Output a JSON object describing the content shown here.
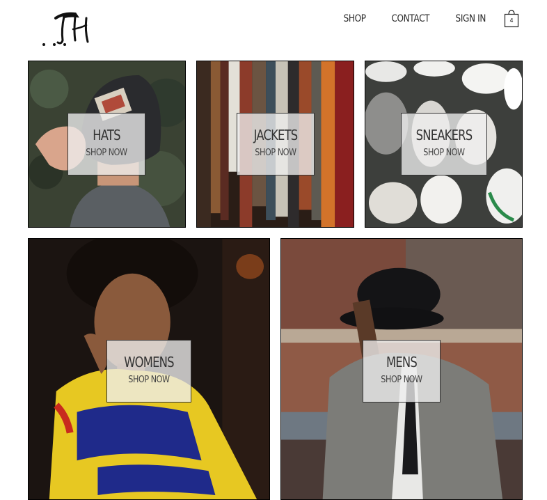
{
  "header": {
    "logo_text": "..TH",
    "nav": [
      {
        "label": "SHOP"
      },
      {
        "label": "CONTACT"
      },
      {
        "label": "SIGN IN"
      }
    ],
    "cart_count": "4",
    "cart_icon": "shopping-bag-icon"
  },
  "categories": [
    {
      "title": "HATS",
      "cta": "SHOP NOW"
    },
    {
      "title": "JACKETS",
      "cta": "SHOP NOW"
    },
    {
      "title": "SNEAKERS",
      "cta": "SHOP NOW"
    },
    {
      "title": "WOMENS",
      "cta": "SHOP NOW"
    },
    {
      "title": "MENS",
      "cta": "SHOP NOW"
    }
  ],
  "colors": {
    "caption_bg": "#eeeeee",
    "text": "#333333",
    "border": "#000000"
  }
}
